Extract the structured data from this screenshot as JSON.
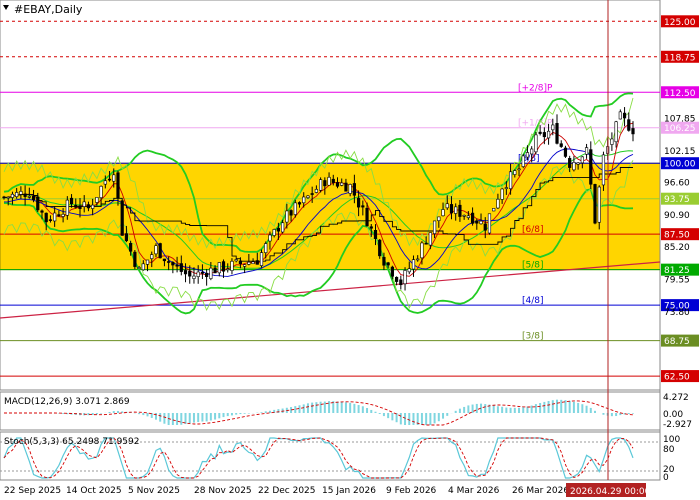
{
  "window": {
    "title": "#EBAY,Daily",
    "icon": "triangle-down-icon"
  },
  "colors": {
    "zone_fill": "#FFD500",
    "zone_border": "#9A8A00",
    "murrey_red": "#D40000",
    "murrey_magenta": "#E600E6",
    "murrey_blue": "#0000D4",
    "murrey_olive": "#6B8E23",
    "candles": "#000000",
    "bollinger": "#22CC22",
    "envelope": "#88DD44",
    "ema_fast": "#CC0000",
    "ema_slow": "#0000CC",
    "trendline": "#CC2244",
    "cursor": "#B22222",
    "macd_hist": "#7FD6E0",
    "macd_signal": "#D40000",
    "stoch_main": "#5BC8D8",
    "stoch_signal": "#D40000"
  },
  "main_chart": {
    "price_range": [
      60.4,
      128.4
    ],
    "levels": [
      {
        "value": 125.0,
        "label": "125.00",
        "tag": "",
        "color": "#D40000",
        "dash": true
      },
      {
        "value": 118.75,
        "label": "118.75",
        "tag": "",
        "color": "#D40000",
        "dash": true
      },
      {
        "value": 112.5,
        "label": "112.50",
        "tag": "[+2/8]P",
        "color": "#E600E6",
        "dash": false
      },
      {
        "value": 106.25,
        "label": "106.25",
        "tag": "[+1/8]P",
        "color": "#F0A8F0",
        "dash": false
      },
      {
        "value": 100.0,
        "label": "100.00",
        "tag": "[8/8]",
        "color": "#0000D4",
        "dash": false
      },
      {
        "value": 93.75,
        "label": "93.75",
        "tag": "",
        "color": "#9ACD32",
        "dash": false
      },
      {
        "value": 87.5,
        "label": "87.50",
        "tag": "[6/8]",
        "color": "#D40000",
        "dash": false
      },
      {
        "value": 81.25,
        "label": "81.25",
        "tag": "[5/8]",
        "color": "#00AA00",
        "dash": false
      },
      {
        "value": 75.0,
        "label": "75.00",
        "tag": "[4/8]",
        "color": "#0000D4",
        "dash": false
      },
      {
        "value": 68.75,
        "label": "68.75",
        "tag": "[3/8]",
        "color": "#6B8E23",
        "dash": false
      },
      {
        "value": 62.5,
        "label": "62.50",
        "tag": "",
        "color": "#D40000",
        "dash": false
      }
    ],
    "scale_ticks": [
      "107.85",
      "102.15",
      "96.60",
      "90.90",
      "85.20",
      "79.55",
      "73.80"
    ],
    "current_price": "106.25",
    "zone": [
      81.25,
      100.0
    ]
  },
  "macd": {
    "label": "MACD(12,26,9) 3.071 2.869",
    "ticks": [
      "4.272",
      "0.00",
      "-2.927"
    ]
  },
  "stoch": {
    "label": "Stoch(5,3,3) 65.2498 71.9592",
    "ticks": [
      "100",
      "80",
      "20",
      "0"
    ]
  },
  "time_axis": {
    "labels": [
      "22 Sep 2025",
      "14 Oct 2025",
      "5 Nov 2025",
      "28 Nov 2025",
      "22 Dec 2025",
      "15 Jan 2026",
      "9 Feb 2026",
      "4 Mar 2026",
      "26 Mar 2026"
    ],
    "cursor_label": "2026.04.29 00:00"
  }
}
